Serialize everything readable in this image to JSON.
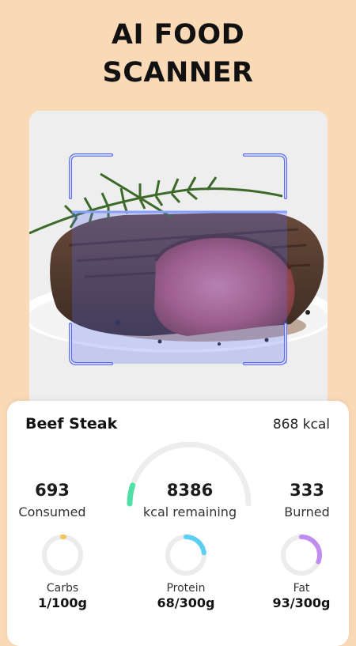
{
  "headline": {
    "line1": "AI FOOD",
    "line2": "SCANNER"
  },
  "result": {
    "food_name": "Beef Steak",
    "food_kcal": "868 kcal",
    "consumed": {
      "value": "693",
      "label": "Consumed"
    },
    "remaining": {
      "value": "8386",
      "label": "kcal remaining"
    },
    "burned": {
      "value": "333",
      "label": "Burned"
    },
    "gauge_fill_fraction": 0.1,
    "gauge_color": "#4fe0a8",
    "macros": [
      {
        "label": "Carbs",
        "value": "1/100g",
        "fraction": 0.01,
        "color": "#f6c35a"
      },
      {
        "label": "Protein",
        "value": "68/300g",
        "fraction": 0.23,
        "color": "#5ccff2"
      },
      {
        "label": "Fat",
        "value": "93/300g",
        "fraction": 0.31,
        "color": "#c08cf0"
      }
    ]
  },
  "colors": {
    "background": "#fad9b7",
    "scan_frame": "#5b6cf0"
  }
}
